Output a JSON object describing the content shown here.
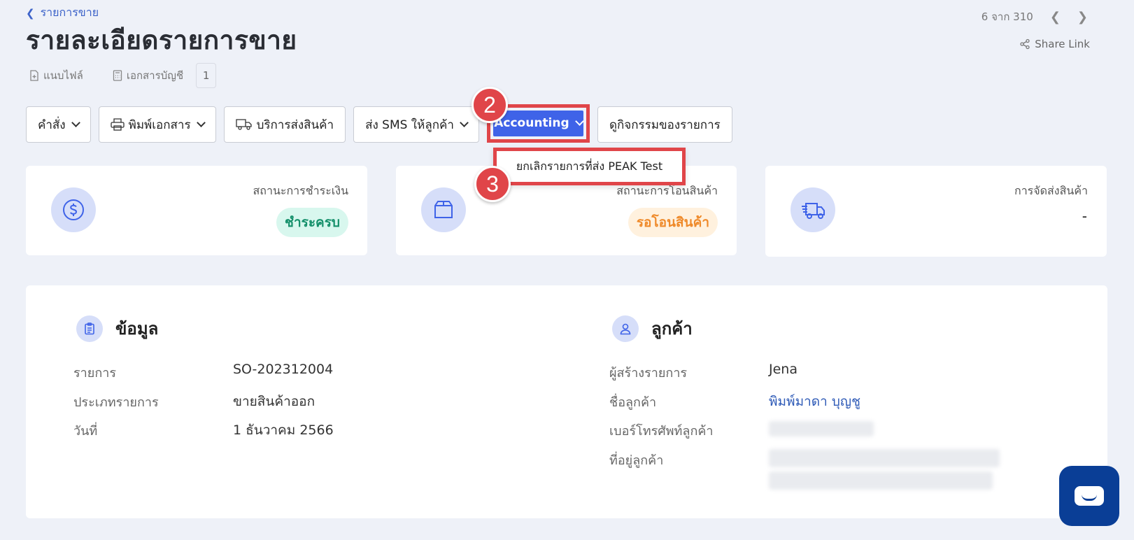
{
  "breadcrumb": {
    "label": "รายการขาย"
  },
  "page": {
    "title": "รายละเอียดรายการขาย"
  },
  "meta": {
    "attach_label": "แนบไฟล์",
    "docs_label": "เอกสารบัญชี",
    "docs_count": "1"
  },
  "pager": {
    "text": "6 จาก 310"
  },
  "share": {
    "label": "Share Link"
  },
  "toolbar": {
    "command_label": "คำสั่ง",
    "print_label": "พิมพ์เอกสาร",
    "shipping_label": "บริการส่งสินค้า",
    "sms_label": "ส่ง SMS ให้ลูกค้า",
    "accounting_label": "Accounting",
    "activity_label": "ดูกิจกรรมของรายการ"
  },
  "dropdown": {
    "cancel_peak_label": "ยกเลิกรายการที่ส่ง PEAK Test"
  },
  "steps": {
    "two": "2",
    "three": "3"
  },
  "cards": {
    "payment": {
      "label": "สถานะการชำระเงิน",
      "status": "ชำระครบ"
    },
    "transfer": {
      "label": "สถานะการโอนสินค้า",
      "status": "รอโอนสินค้า"
    },
    "delivery": {
      "label": "การจัดส่งสินค้า",
      "status": "-"
    }
  },
  "info": {
    "title": "ข้อมูล",
    "rows": [
      {
        "label": "รายการ",
        "value": "SO-202312004"
      },
      {
        "label": "ประเภทรายการ",
        "value": "ขายสินค้าออก"
      },
      {
        "label": "วันที่",
        "value": "1 ธันวาคม 2566"
      }
    ]
  },
  "customer": {
    "title": "ลูกค้า",
    "rows": [
      {
        "label": "ผู้สร้างรายการ",
        "value": "Jena"
      },
      {
        "label": "ชื่อลูกค้า",
        "value": "พิมพ์มาดา บุญชู"
      },
      {
        "label": "เบอร์โทรศัพท์ลูกค้า",
        "value": ""
      },
      {
        "label": "ที่อยู่ลูกค้า",
        "value": ""
      }
    ]
  },
  "colors": {
    "accent": "#3f63e8",
    "highlight": "#e04549",
    "paid": "#15906b",
    "pending": "#ef8a2a",
    "chat": "#0a3e96"
  }
}
